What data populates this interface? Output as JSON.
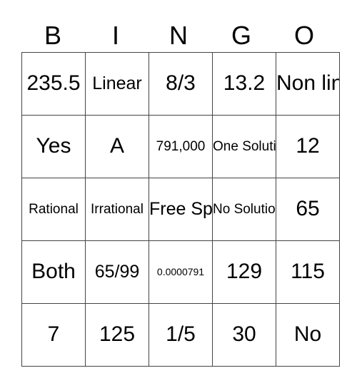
{
  "header": {
    "letters": [
      "B",
      "I",
      "N",
      "G",
      "O"
    ]
  },
  "rows": [
    [
      {
        "text": "235.5",
        "size": "l"
      },
      {
        "text": "Linear",
        "size": "m"
      },
      {
        "text": "8/3",
        "size": "l"
      },
      {
        "text": "13.2",
        "size": "l"
      },
      {
        "text": "Non linear",
        "size": "l",
        "wrap": true
      }
    ],
    [
      {
        "text": "Yes",
        "size": "l"
      },
      {
        "text": "A",
        "size": "l"
      },
      {
        "text": "791,000",
        "size": "s"
      },
      {
        "text": "One Solution",
        "size": "s",
        "wrap": true
      },
      {
        "text": "12",
        "size": "l"
      }
    ],
    [
      {
        "text": "Rational",
        "size": "s"
      },
      {
        "text": "Irrational",
        "size": "s"
      },
      {
        "text": "Free Space",
        "size": "m",
        "wrap": true
      },
      {
        "text": "No Solution",
        "size": "s",
        "wrap": true
      },
      {
        "text": "65",
        "size": "l"
      }
    ],
    [
      {
        "text": "Both",
        "size": "l"
      },
      {
        "text": "65/99",
        "size": "m"
      },
      {
        "text": "0.0000791",
        "size": "xxs"
      },
      {
        "text": "129",
        "size": "l"
      },
      {
        "text": "115",
        "size": "l"
      }
    ],
    [
      {
        "text": "7",
        "size": "l"
      },
      {
        "text": "125",
        "size": "l"
      },
      {
        "text": "1/5",
        "size": "l"
      },
      {
        "text": "30",
        "size": "l"
      },
      {
        "text": "No",
        "size": "l"
      }
    ]
  ]
}
